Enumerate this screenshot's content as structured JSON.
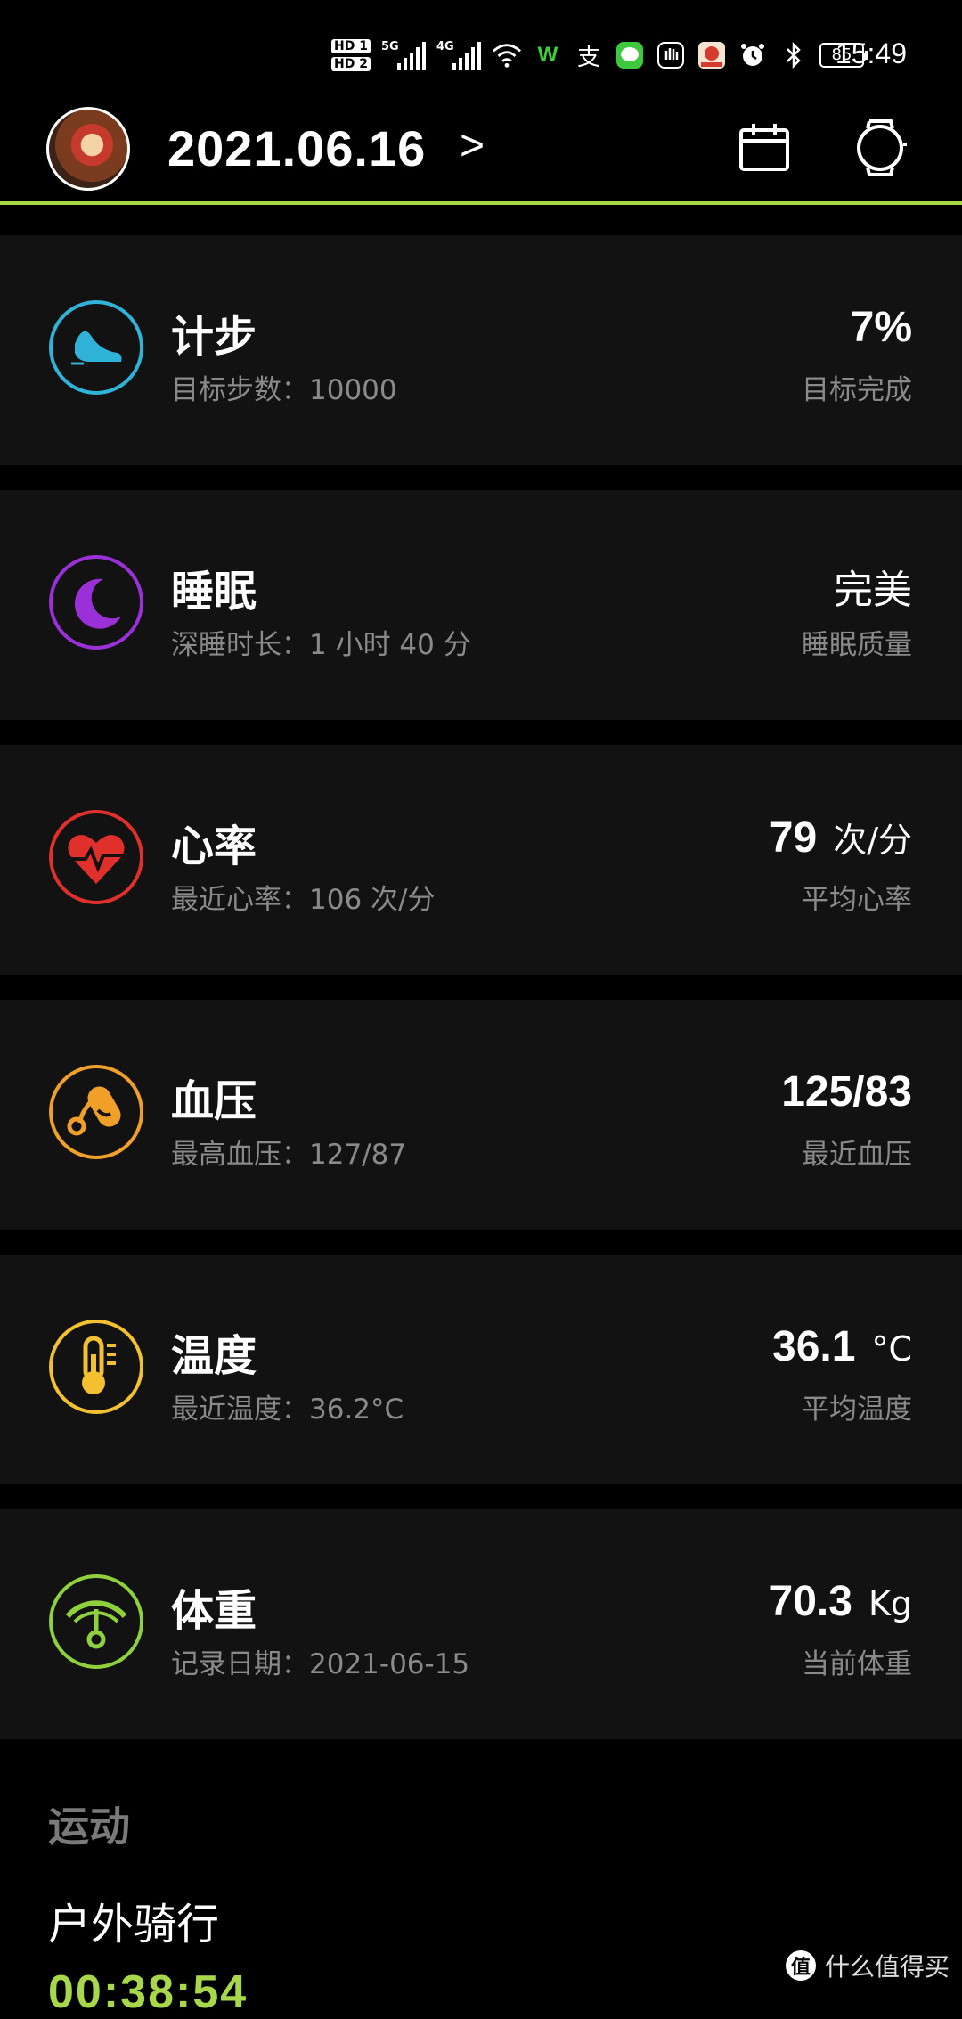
{
  "status_bar": {
    "hd1": "HD 1",
    "hd2": "HD 2",
    "sig1_label": "5G",
    "sig2_label": "4G",
    "wifi_label": "6",
    "battery": "85",
    "time": "15:49",
    "icons": [
      "wifi-icon",
      "wechat-icon",
      "alipay-icon",
      "line-icon",
      "hand-icon",
      "app-icon",
      "alarm-icon",
      "bluetooth-icon"
    ]
  },
  "header": {
    "date": "2021.06.16",
    "arrow": ">",
    "accent_color": "#a8d84a"
  },
  "cards": [
    {
      "id": "steps",
      "title": "计步",
      "subtitle": "目标步数：10000",
      "value": "7%",
      "unit": "",
      "value_label": "目标完成",
      "color": "#2fb3d8",
      "icon": "shoe-icon"
    },
    {
      "id": "sleep",
      "title": "睡眠",
      "subtitle": "深睡时长：1 小时 40 分",
      "value": "完美",
      "unit": "",
      "value_label": "睡眠质量",
      "color": "#9b30d9",
      "icon": "moon-icon"
    },
    {
      "id": "heart",
      "title": "心率",
      "subtitle": "最近心率：106 次/分",
      "value": "79",
      "unit": "次/分",
      "value_label": "平均心率",
      "color": "#e0302c",
      "icon": "heart-icon"
    },
    {
      "id": "bp",
      "title": "血压",
      "subtitle": "最高血压：127/87",
      "value": "125/83",
      "unit": "",
      "value_label": "最近血压",
      "color": "#f0a028",
      "icon": "blood-pressure-icon"
    },
    {
      "id": "temp",
      "title": "温度",
      "subtitle": "最近温度：36.2°C",
      "value": "36.1",
      "unit": "°C",
      "value_label": "平均温度",
      "color": "#f2c030",
      "icon": "thermometer-icon"
    },
    {
      "id": "weight",
      "title": "体重",
      "subtitle": "记录日期：2021-06-15",
      "value": "70.3",
      "unit": "Kg",
      "value_label": "当前体重",
      "color": "#8fd13c",
      "icon": "scale-icon"
    }
  ],
  "sport": {
    "heading": "运动",
    "item": "户外骑行",
    "time": "00:38:54"
  },
  "watermark": {
    "logo": "值",
    "text": "什么值得买"
  }
}
